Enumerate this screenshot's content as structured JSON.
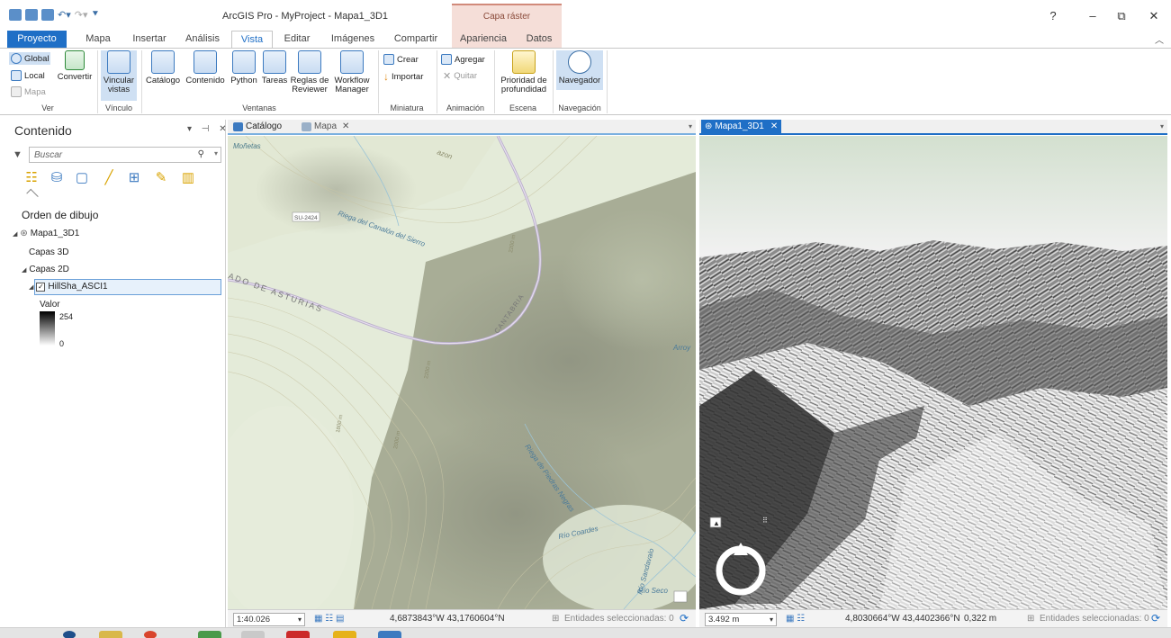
{
  "window": {
    "title": "ArcGIS Pro - MyProject - Mapa1_3D1",
    "context_tab_group": "Capa ráster",
    "buttons": {
      "help": "?",
      "minimize": "–",
      "restore": "⧉",
      "close": "✕"
    }
  },
  "ribbon_tabs": [
    "Proyecto",
    "Mapa",
    "Insertar",
    "Análisis",
    "Vista",
    "Editar",
    "Imágenes",
    "Compartir",
    "Apariencia",
    "Datos"
  ],
  "active_tab": "Vista",
  "ribbon": {
    "ver": {
      "label": "Ver",
      "global": "Global",
      "local": "Local",
      "mapa": "Mapa",
      "convertir": "Convertir"
    },
    "vinculo": {
      "label": "Vínculo",
      "vincular": "Vincular",
      "vistas": "vistas"
    },
    "ventanas": {
      "label": "Ventanas",
      "catalogo": "Catálogo",
      "contenido": "Contenido",
      "python": "Python",
      "tareas": "Tareas",
      "reglas_1": "Reglas de",
      "reglas_2": "Reviewer",
      "workflow_1": "Workflow",
      "workflow_2": "Manager"
    },
    "miniatura": {
      "label": "Miniatura",
      "crear": "Crear",
      "importar": "Importar"
    },
    "animacion": {
      "label": "Animación",
      "agregar": "Agregar",
      "quitar": "Quitar"
    },
    "escena": {
      "label": "Escena",
      "prioridad_1": "Prioridad de",
      "prioridad_2": "profundidad"
    },
    "navegacion": {
      "label": "Navegación",
      "navegador": "Navegador"
    }
  },
  "contents": {
    "title": "Contenido",
    "controls": "▾ ⊣ ✕",
    "search_placeholder": "Buscar",
    "draw_order": "Orden de dibujo",
    "tree": {
      "map": "Mapa1_3D1",
      "layers_3d": "Capas 3D",
      "layers_2d": "Capas 2D",
      "layer": "HillSha_ASCI1",
      "legend_title": "Valor",
      "legend_max": "254",
      "legend_min": "0"
    }
  },
  "views": {
    "map_tabs": [
      "Catálogo",
      "Mapa"
    ],
    "scene_tab": "Mapa1_3D1"
  },
  "map_labels": {
    "l1": "Moñetas",
    "l2": "SU-2424",
    "l3": "Riega del Canalón del Sierro",
    "l4": "ADO DE ASTURIAS",
    "l5": "CANTABRIA",
    "l6": "Arroy",
    "l7": "Riega de Piedras Negras",
    "l8": "Río Coardes",
    "l9": "Río Sandavalo",
    "l10": "Río Seco",
    "l11": "2200 m",
    "l12": "1800 m",
    "l13": "2000 m",
    "l14": "2200 m",
    "l15": "azon"
  },
  "status_2d": {
    "scale": "1:40.026",
    "coords": "4,6873843°W 43,1760604°N",
    "selected": "Entidades seleccionadas: 0"
  },
  "status_3d": {
    "scale": "3.492 m",
    "coords": "4,8030664°W 43,4402366°N",
    "elevation": "0,322 m",
    "selected": "Entidades seleccionadas: 0"
  },
  "colors": {
    "accent": "#1f6fc6",
    "context_tab": "#f5ded8",
    "map_green": "#dfe8d8",
    "terrain_dark": "#2a2a2a"
  }
}
